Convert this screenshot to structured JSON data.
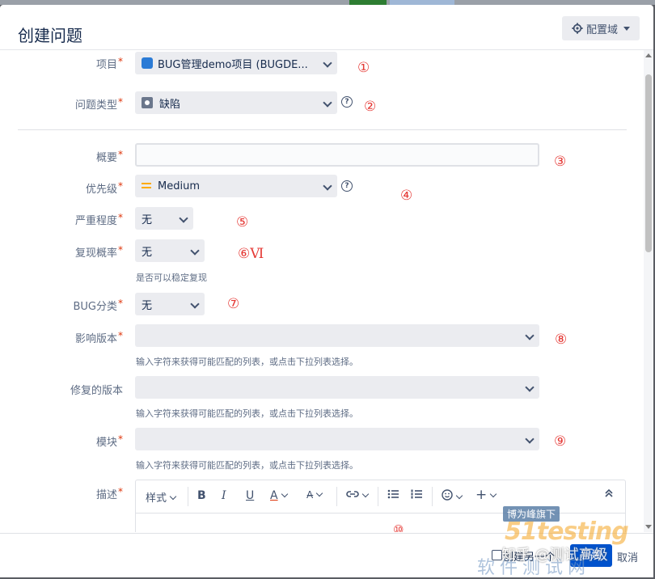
{
  "dialog": {
    "title": "创建问题",
    "config_label": "配置域"
  },
  "fields": {
    "project": {
      "label": "项目",
      "value": "BUG管理demo项目 (BUGDE..."
    },
    "issue_type": {
      "label": "问题类型",
      "value": "缺陷"
    },
    "summary": {
      "label": "概要",
      "value": ""
    },
    "priority": {
      "label": "优先级",
      "value": "Medium"
    },
    "severity": {
      "label": "严重程度",
      "value": "无"
    },
    "reproducibility": {
      "label": "复现概率",
      "value": "无",
      "hint": "是否可以稳定复现"
    },
    "bug_category": {
      "label": "BUG分类",
      "value": "无"
    },
    "affects_version": {
      "label": "影响版本",
      "hint": "输入字符来获得可能匹配的列表，或点击下拉列表选择。"
    },
    "fix_version": {
      "label": "修复的版本",
      "hint": "输入字符来获得可能匹配的列表，或点击下拉列表选择。"
    },
    "component": {
      "label": "模块",
      "hint": "输入字符来获得可能匹配的列表，或点击下拉列表选择。"
    },
    "description": {
      "label": "描述",
      "style_label": "样式"
    }
  },
  "annotations": [
    "①",
    "②",
    "③",
    "④",
    "⑤",
    "⑥Ⅵ",
    "⑦",
    "⑧",
    "⑨",
    "⑩"
  ],
  "footer": {
    "create_another": "创建另一个",
    "create": "新建",
    "cancel": "取消"
  },
  "watermarks": {
    "brand_tag": "博为峰旗下",
    "brand": "51testing",
    "brand_cn": "软件测试网",
    "zhihu": "知乎 @测试高级"
  },
  "colors": {
    "primary": "#0052cc",
    "required": "#de350b",
    "annotation": "#e53935",
    "priority": "#ffab00"
  }
}
